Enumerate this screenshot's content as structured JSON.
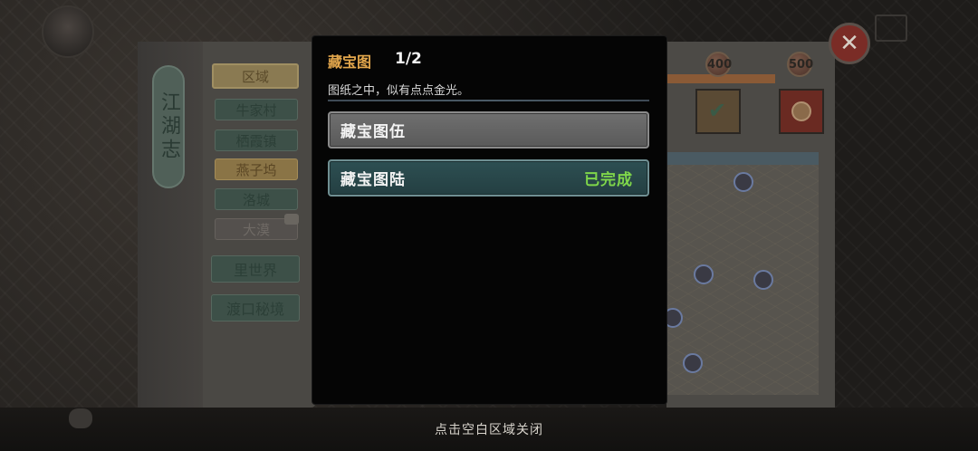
{
  "modal": {
    "title": "藏宝图",
    "progress": "1/2",
    "description": "图纸之中，似有点点金光。",
    "items": [
      {
        "name": "藏宝图伍",
        "status": ""
      },
      {
        "name": "藏宝图陆",
        "status": "已完成"
      }
    ]
  },
  "left_panel": {
    "title": "江湖志",
    "region_header": "区域",
    "regions": [
      "牛家村",
      "栖霞镇",
      "燕子坞",
      "洛城",
      "大漠"
    ],
    "special_buttons": [
      "里世界",
      "渡口秘境"
    ]
  },
  "right_panel": {
    "score_markers": [
      "400",
      "500"
    ]
  },
  "footer": {
    "close_hint": "点击空白区域关闭"
  },
  "colors": {
    "title_gold": "#e2a64c",
    "completed_green": "#7fd64a",
    "modal_bg": "#050505"
  },
  "icons": {
    "close": "close-icon",
    "checkmark": "checkmark-icon",
    "gift": "gift-icon",
    "chat": "chat-icon"
  }
}
